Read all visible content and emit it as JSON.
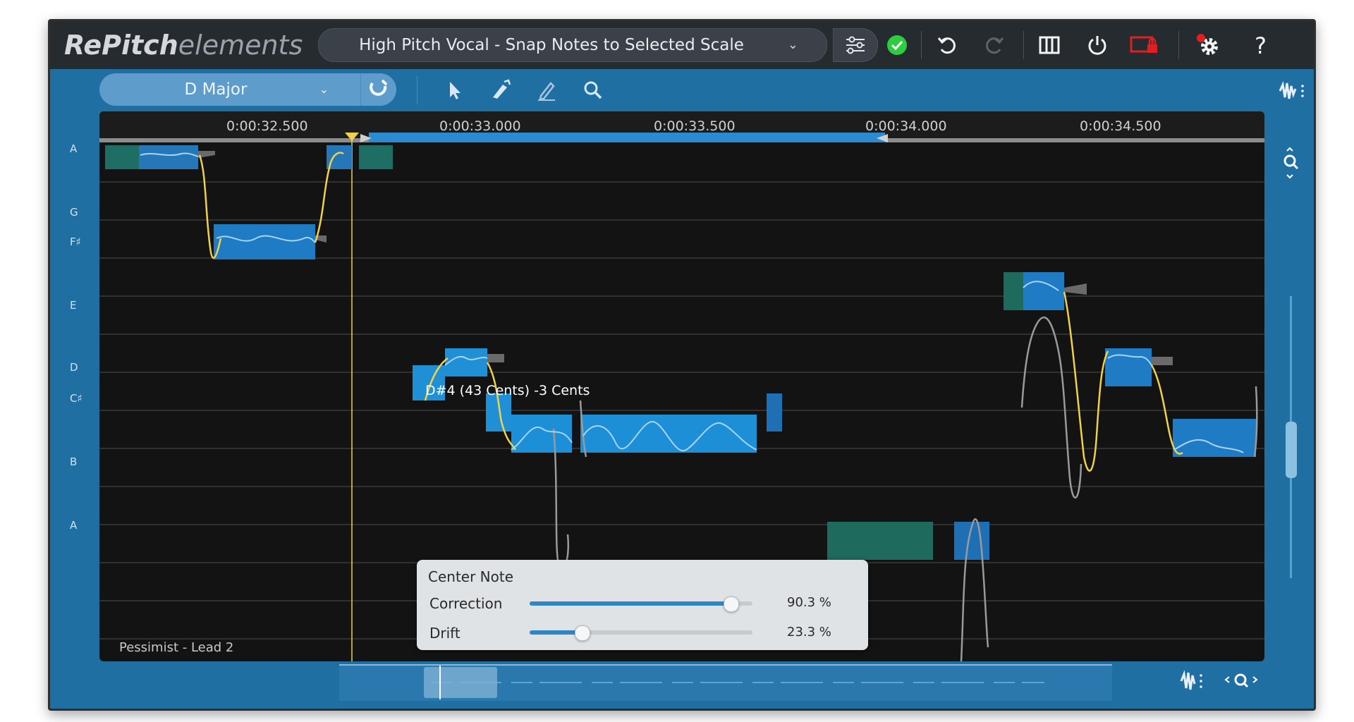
{
  "app": {
    "logo_bold": "RePitch",
    "logo_light": "elements"
  },
  "titlebar": {
    "preset_name": "High Pitch Vocal - Snap Notes to Selected Scale",
    "preset_arrow": "⌄",
    "icons": [
      "settings-sliders-icon",
      "status-check-icon",
      "undo-icon",
      "redo-icon",
      "columns-icon",
      "power-icon",
      "record-lock-icon",
      "prefs-gear-icon",
      "help-icon"
    ]
  },
  "toolbar": {
    "scale_name": "D Major",
    "scale_arrow": "⌄",
    "tools": [
      "pointer-tool-icon",
      "pitch-tool-icon",
      "pen-tool-icon",
      "zoom-tool-icon"
    ]
  },
  "ruler": {
    "times": [
      "0:00:32.500",
      "0:00:33.000",
      "0:00:33.500",
      "0:00:34.000",
      "0:00:34.500"
    ]
  },
  "notes": [
    "A",
    "G",
    "F♯",
    "E",
    "D",
    "C♯",
    "B",
    "A"
  ],
  "track_name": "Pessimist - Lead 2",
  "tooltip": "D#4 (43 Cents) -3 Cents",
  "panel": {
    "title": "Center Note",
    "correction_label": "Correction",
    "correction_value": "90.3 %",
    "correction_fraction": 0.903,
    "drift_label": "Drift",
    "drift_value": "23.3 %",
    "drift_fraction": 0.233
  },
  "colors": {
    "accent": "#2f86c4",
    "status_ok": "#2ecc40",
    "pitch_curve": "#f0d24a",
    "note_block": "#1c8fd6"
  }
}
